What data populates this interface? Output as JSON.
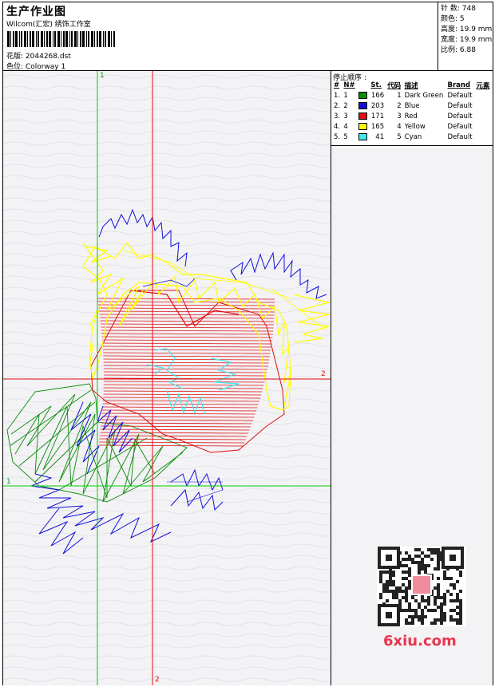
{
  "header": {
    "title": "生产作业图",
    "subtitle": "Wilcom(汇宏) 绣饰工作室",
    "design_label": "花版:",
    "design_value": "2044268.dst",
    "colorway_label": "色位:",
    "colorway_value": "Colorway 1"
  },
  "stats": {
    "stitches": "针 数: 748",
    "colors": "颜色: 5",
    "height": "高度: 19.9 mm",
    "width": "宽度: 19.9 mm",
    "scale": "比例: 6.88"
  },
  "stop_sequence": {
    "title": "停止顺序 :",
    "headers": [
      "#",
      "N#",
      "St.",
      "代码",
      "描述",
      "Brand",
      "元素"
    ],
    "rows": [
      {
        "idx": "1.",
        "n": "1",
        "color": "#0a8c0a",
        "st": "166",
        "code": "1",
        "desc": "Dark Green",
        "brand": "Default"
      },
      {
        "idx": "2.",
        "n": "2",
        "color": "#1010d8",
        "st": "203",
        "code": "2",
        "desc": "Blue",
        "brand": "Default"
      },
      {
        "idx": "3.",
        "n": "3",
        "color": "#e01010",
        "st": "171",
        "code": "3",
        "desc": "Red",
        "brand": "Default"
      },
      {
        "idx": "4.",
        "n": "4",
        "color": "#ffff00",
        "st": "165",
        "code": "4",
        "desc": "Yellow",
        "brand": "Default"
      },
      {
        "idx": "5.",
        "n": "5",
        "color": "#40e8f0",
        "st": "41",
        "code": "5",
        "desc": "Cyan",
        "brand": "Default"
      }
    ]
  },
  "axes": {
    "green_v_label": "1",
    "green_h_label": "1",
    "red_v_label": "2",
    "red_h_label": "2"
  },
  "watermark": {
    "brand": "6xiu.com"
  }
}
